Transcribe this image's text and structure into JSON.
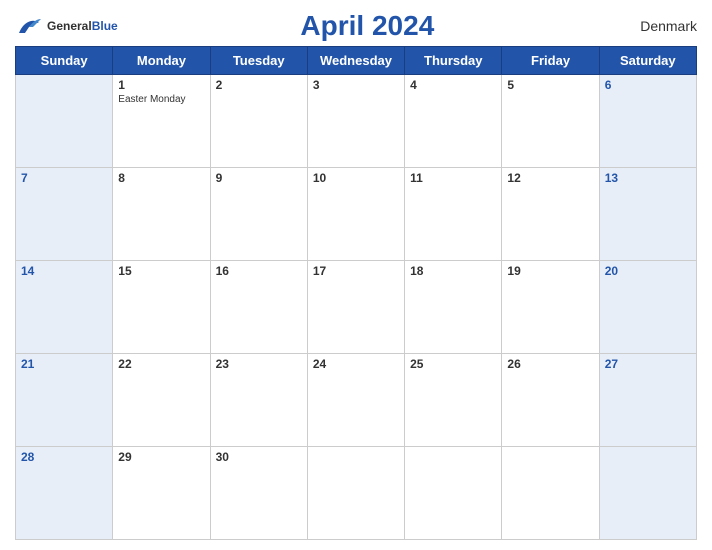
{
  "header": {
    "title": "April 2024",
    "country": "Denmark",
    "logo_general": "General",
    "logo_blue": "Blue"
  },
  "days": [
    "Sunday",
    "Monday",
    "Tuesday",
    "Wednesday",
    "Thursday",
    "Friday",
    "Saturday"
  ],
  "weeks": [
    [
      {
        "date": "",
        "holiday": ""
      },
      {
        "date": "1",
        "holiday": "Easter Monday"
      },
      {
        "date": "2",
        "holiday": ""
      },
      {
        "date": "3",
        "holiday": ""
      },
      {
        "date": "4",
        "holiday": ""
      },
      {
        "date": "5",
        "holiday": ""
      },
      {
        "date": "6",
        "holiday": ""
      }
    ],
    [
      {
        "date": "7",
        "holiday": ""
      },
      {
        "date": "8",
        "holiday": ""
      },
      {
        "date": "9",
        "holiday": ""
      },
      {
        "date": "10",
        "holiday": ""
      },
      {
        "date": "11",
        "holiday": ""
      },
      {
        "date": "12",
        "holiday": ""
      },
      {
        "date": "13",
        "holiday": ""
      }
    ],
    [
      {
        "date": "14",
        "holiday": ""
      },
      {
        "date": "15",
        "holiday": ""
      },
      {
        "date": "16",
        "holiday": ""
      },
      {
        "date": "17",
        "holiday": ""
      },
      {
        "date": "18",
        "holiday": ""
      },
      {
        "date": "19",
        "holiday": ""
      },
      {
        "date": "20",
        "holiday": ""
      }
    ],
    [
      {
        "date": "21",
        "holiday": ""
      },
      {
        "date": "22",
        "holiday": ""
      },
      {
        "date": "23",
        "holiday": ""
      },
      {
        "date": "24",
        "holiday": ""
      },
      {
        "date": "25",
        "holiday": ""
      },
      {
        "date": "26",
        "holiday": ""
      },
      {
        "date": "27",
        "holiday": ""
      }
    ],
    [
      {
        "date": "28",
        "holiday": ""
      },
      {
        "date": "29",
        "holiday": ""
      },
      {
        "date": "30",
        "holiday": ""
      },
      {
        "date": "",
        "holiday": ""
      },
      {
        "date": "",
        "holiday": ""
      },
      {
        "date": "",
        "holiday": ""
      },
      {
        "date": "",
        "holiday": ""
      }
    ]
  ]
}
